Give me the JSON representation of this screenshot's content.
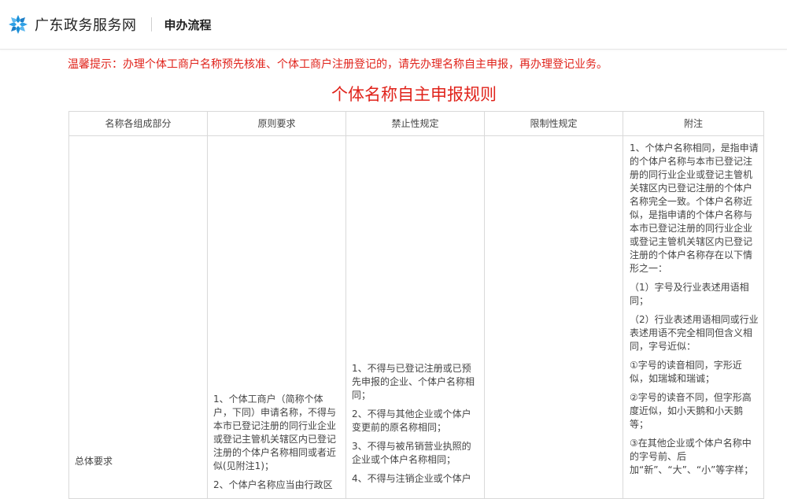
{
  "header": {
    "site_title": "广东政务服务网",
    "section_title": "申办流程"
  },
  "notice": "温馨提示：办理个体工商户名称预先核准、个体工商户注册登记的，请先办理名称自主申报，再办理登记业务。",
  "rules_title": "个体名称自主申报规则",
  "table": {
    "headers": [
      "名称各组成部分",
      "原则要求",
      "禁止性规定",
      "限制性规定",
      "附注"
    ],
    "row": {
      "name": "总体要求",
      "principle": [
        "1、个体工商户（简称个体户，下同）申请名称，不得与本市已登记注册的同行业企业或登记主管机关辖区内已登记注册的个体户名称相同或者近似(见附注1)；",
        "2、个体户名称应当由行政区"
      ],
      "prohibit": [
        "1、不得与已登记注册或已预先申报的企业、个体户名称相同；",
        "2、不得与其他企业或个体户变更前的原名称相同；",
        "3、不得与被吊销营业执照的企业或个体户名称相同；",
        "4、不得与注销企业或个体户"
      ],
      "limit": "",
      "note": [
        "1、个体户名称相同，是指申请的个体户名称与本市已登记注册的同行业企业或登记主管机关辖区内已登记注册的个体户名称完全一致。个体户名称近似，是指申请的个体户名称与本市已登记注册的同行业企业或登记主管机关辖区内已登记注册的个体户名称存在以下情形之一：",
        "（1）字号及行业表述用语相同；",
        "（2）行业表述用语相同或行业表述用语不完全相同但含义相同，字号近似：",
        "①字号的读音相同，字形近似，如瑞城和瑞诚；",
        "②字号的读音不同，但字形高度近似，如小天鹅和小天鹅等；",
        "③在其他企业或个体户名称中的字号前、后加“新”、“大”、“小”等字样；"
      ]
    }
  },
  "colors": {
    "accent_red": "#e0231b",
    "logo_blue": "#1a8fd8"
  },
  "icons": {
    "logo": "guangdong-gov-logo-icon"
  }
}
